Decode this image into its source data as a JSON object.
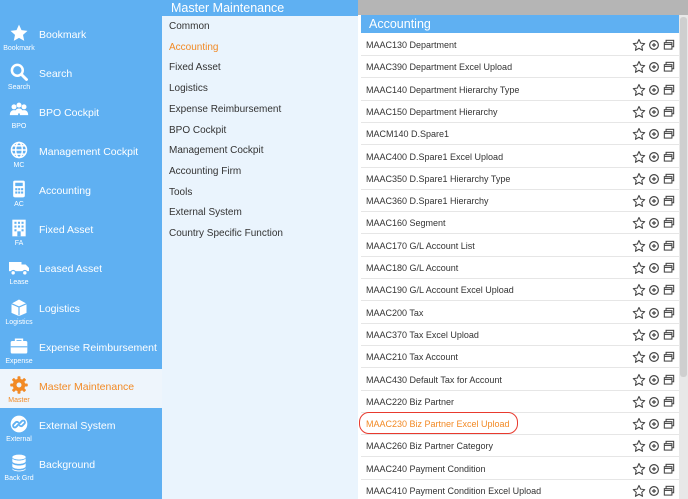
{
  "nav": {
    "items": [
      {
        "label": "Bookmark",
        "caption": "Bookmark",
        "icon": "star-icon"
      },
      {
        "label": "Search",
        "caption": "Search",
        "icon": "search-icon"
      },
      {
        "label": "BPO Cockpit",
        "caption": "BPO",
        "icon": "people-icon"
      },
      {
        "label": "Management Cockpit",
        "caption": "MC",
        "icon": "globe-icon"
      },
      {
        "label": "Accounting",
        "caption": "AC",
        "icon": "calculator-icon"
      },
      {
        "label": "Fixed Asset",
        "caption": "FA",
        "icon": "building-icon"
      },
      {
        "label": "Leased Asset",
        "caption": "Lease",
        "icon": "truck-icon"
      },
      {
        "label": "Logistics",
        "caption": "Logistics",
        "icon": "box-icon"
      },
      {
        "label": "Expense Reimbursement",
        "caption": "Expense",
        "icon": "briefcase-icon"
      },
      {
        "label": "Master Maintenance",
        "caption": "Master",
        "icon": "gear-icon"
      },
      {
        "label": "External System",
        "caption": "External",
        "icon": "link-icon"
      },
      {
        "label": "Background",
        "caption": "Back Grd",
        "icon": "database-icon"
      }
    ]
  },
  "middle": {
    "title": "Master Maintenance",
    "categories": [
      "Common",
      "Accounting",
      "Fixed Asset",
      "Logistics",
      "Expense Reimbursement",
      "BPO Cockpit",
      "Management Cockpit",
      "Accounting Firm",
      "Tools",
      "External System",
      "Country Specific Function"
    ]
  },
  "right": {
    "title": "Accounting",
    "items": [
      "MAAC130 Department",
      "MAAC390 Department Excel Upload",
      "MAAC140 Department Hierarchy Type",
      "MAAC150 Department Hierarchy",
      "MACM140 D.Spare1",
      "MAAC400 D.Spare1 Excel Upload",
      "MAAC350 D.Spare1 Hierarchy Type",
      "MAAC360 D.Spare1 Hierarchy",
      "MAAC160 Segment",
      "MAAC170 G/L Account List",
      "MAAC180 G/L Account",
      "MAAC190 G/L Account Excel Upload",
      "MAAC200 Tax",
      "MAAC370 Tax Excel Upload",
      "MAAC210 Tax Account",
      "MAAC430 Default Tax for Account",
      "MAAC220 Biz Partner",
      "MAAC230 Biz Partner Excel Upload",
      "MAAC260 Biz Partner Category",
      "MAAC240 Payment Condition",
      "MAAC410 Payment Condition Excel Upload"
    ],
    "action_icons": [
      "star-outline-icon",
      "plus-circle-icon",
      "window-icon"
    ]
  },
  "state": {
    "active_nav": "Master Maintenance",
    "active_category": "Accounting",
    "highlighted_item": "MAAC230 Biz Partner Excel Upload"
  },
  "colors": {
    "nav_bg": "#5fb0f2",
    "active_text": "#f28a25",
    "highlight_ring": "#e83a2e",
    "middle_bg": "#eaf4fd"
  }
}
